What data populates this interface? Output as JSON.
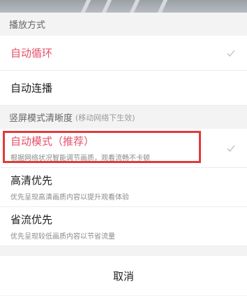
{
  "play_mode": {
    "header": "播放方式",
    "options": [
      {
        "label": "自动循环",
        "selected": true
      },
      {
        "label": "自动连播",
        "selected": false
      }
    ]
  },
  "clarity": {
    "header": "竖屏模式清晰度",
    "header_note": "(移动网络下生效)",
    "options": [
      {
        "label": "自动模式（推荐）",
        "desc": "根据网络状况智能调节画质，观看流畅不卡顿",
        "selected": true
      },
      {
        "label": "高清优先",
        "desc": "优先呈现高清画质内容以提升观看体验",
        "selected": false
      },
      {
        "label": "省流优先",
        "desc": "优先呈现较低画质内容以节省流量",
        "selected": false
      }
    ]
  },
  "cancel_label": "取消",
  "colors": {
    "accent": "#e6506b",
    "highlight_border": "#e23a3a",
    "check": "#bdbdbd"
  },
  "icons": {
    "selected_mark": "check-icon"
  }
}
